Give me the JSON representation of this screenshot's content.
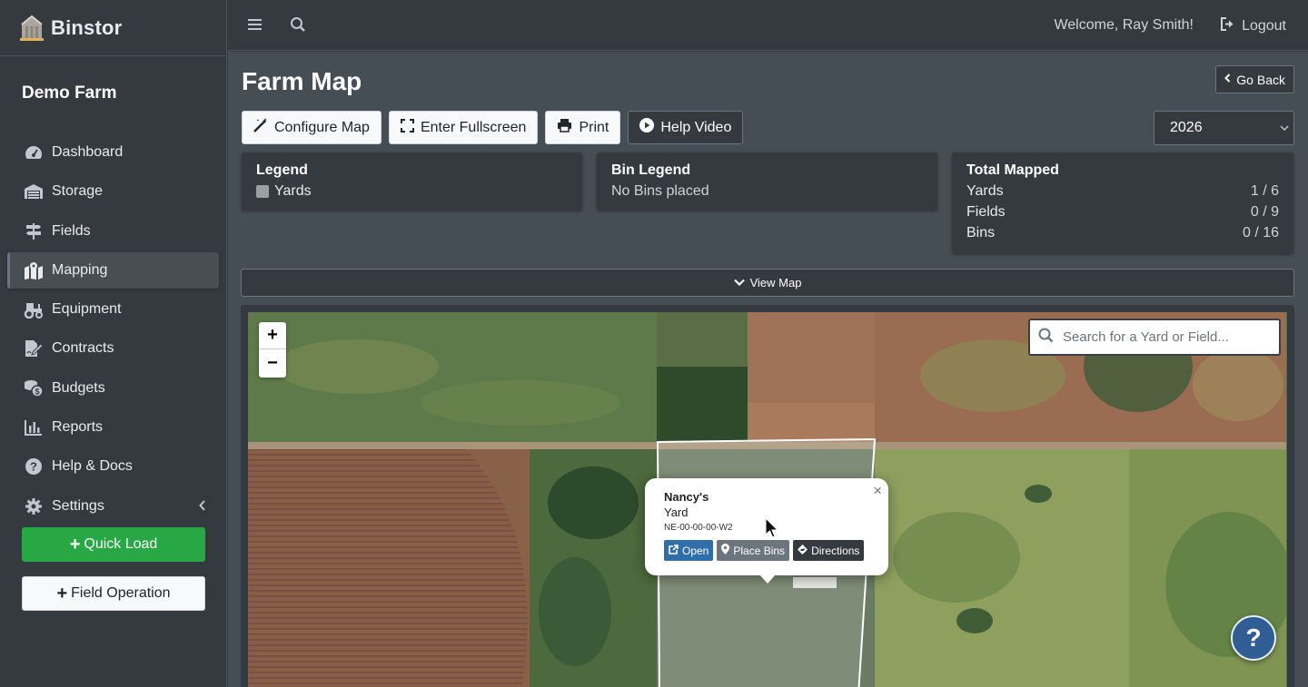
{
  "app": {
    "brand": "Binstor",
    "farm_name": "Demo Farm"
  },
  "sidebar": {
    "items": [
      {
        "label": "Dashboard",
        "icon": "tachometer-icon"
      },
      {
        "label": "Storage",
        "icon": "warehouse-icon"
      },
      {
        "label": "Fields",
        "icon": "signpost-icon"
      },
      {
        "label": "Mapping",
        "icon": "map-marked-icon",
        "active": true
      },
      {
        "label": "Equipment",
        "icon": "tractor-icon"
      },
      {
        "label": "Contracts",
        "icon": "file-signature-icon"
      },
      {
        "label": "Budgets",
        "icon": "coins-icon"
      },
      {
        "label": "Reports",
        "icon": "chart-bar-icon"
      },
      {
        "label": "Help & Docs",
        "icon": "question-circle-icon"
      },
      {
        "label": "Settings",
        "icon": "gear-icon"
      }
    ],
    "quick_load": "Quick Load",
    "field_operation": "Field Operation"
  },
  "topbar": {
    "welcome": "Welcome, Ray Smith!",
    "logout": "Logout"
  },
  "page": {
    "title": "Farm Map",
    "go_back": "Go Back",
    "toolbar": {
      "configure": "Configure Map",
      "fullscreen": "Enter Fullscreen",
      "print": "Print",
      "help_video": "Help Video"
    },
    "year": "2026",
    "view_map": "View Map"
  },
  "legend": {
    "title": "Legend",
    "items": [
      {
        "label": "Yards",
        "color": "#9aa0a6"
      }
    ]
  },
  "bin_legend": {
    "title": "Bin Legend",
    "text": "No Bins placed"
  },
  "total_mapped": {
    "title": "Total Mapped",
    "rows": [
      {
        "label": "Yards",
        "value": "1 / 6"
      },
      {
        "label": "Fields",
        "value": "0 / 9"
      },
      {
        "label": "Bins",
        "value": "0 / 16"
      }
    ]
  },
  "map": {
    "search_placeholder": "Search for a Yard or Field...",
    "zoom_in": "+",
    "zoom_out": "−",
    "popup": {
      "close": "×",
      "name": "Nancy's",
      "type": "Yard",
      "location": "NE-00-00-00-W2",
      "buttons": {
        "open": "Open",
        "place_bins": "Place Bins",
        "directions": "Directions"
      }
    },
    "help_fab": "?"
  },
  "colors": {
    "accent_green": "#28a745",
    "sidebar_bg": "#343a40",
    "content_bg": "#454d55",
    "popup_blue": "#2f6ea8"
  }
}
